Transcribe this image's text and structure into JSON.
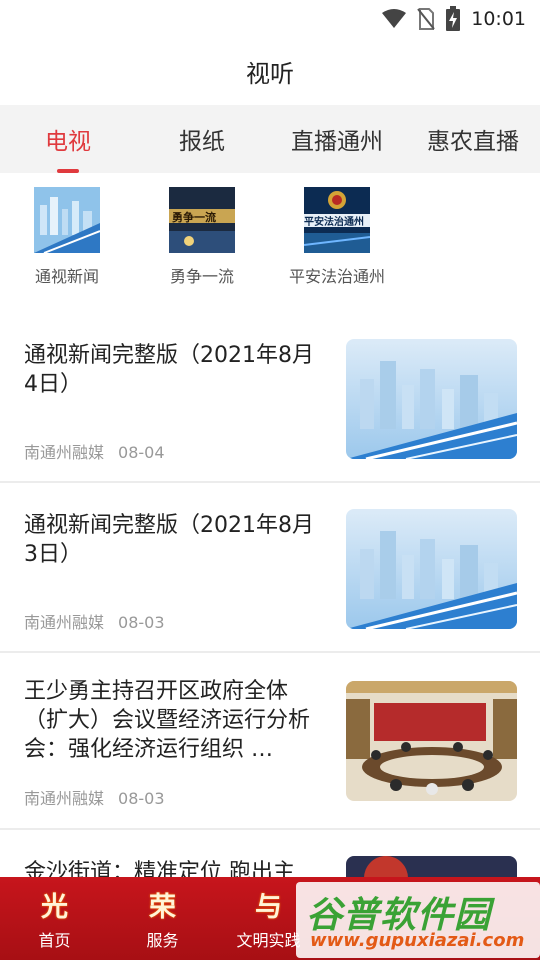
{
  "status": {
    "time": "10:01"
  },
  "page": {
    "title": "视听"
  },
  "tabs": [
    {
      "label": "电视",
      "active": true
    },
    {
      "label": "报纸",
      "active": false
    },
    {
      "label": "直播通州",
      "active": false
    },
    {
      "label": "惠农直播",
      "active": false
    }
  ],
  "channels": [
    {
      "label": "通视新闻",
      "thumb_text": ""
    },
    {
      "label": "勇争一流",
      "thumb_text": "勇争一流"
    },
    {
      "label": "平安法治通州",
      "thumb_text": "平安法治通州"
    }
  ],
  "news": [
    {
      "title": "通视新闻完整版（2021年8月4日）",
      "source": "南通州融媒",
      "date": "08-04"
    },
    {
      "title": "通视新闻完整版（2021年8月3日）",
      "source": "南通州融媒",
      "date": "08-03"
    },
    {
      "title": "王少勇主持召开区政府全体（扩大）会议暨经济运行分析会：强化经济运行组织 …",
      "source": "南通州融媒",
      "date": "08-03"
    },
    {
      "title": "金沙街道：精准定位 跑出主",
      "source": "",
      "date": ""
    }
  ],
  "bottom_nav": [
    {
      "glyph": "光",
      "label": "首页"
    },
    {
      "glyph": "荣",
      "label": "服务"
    },
    {
      "glyph": "与",
      "label": "文明实践"
    }
  ],
  "watermark": {
    "text": "谷普软件园",
    "url": "www.gupuxiazai.com"
  },
  "colors": {
    "accent": "#e03a3e",
    "nav_bg": "#c7151c",
    "watermark_green": "#3aa235",
    "watermark_orange": "#e35a16"
  }
}
